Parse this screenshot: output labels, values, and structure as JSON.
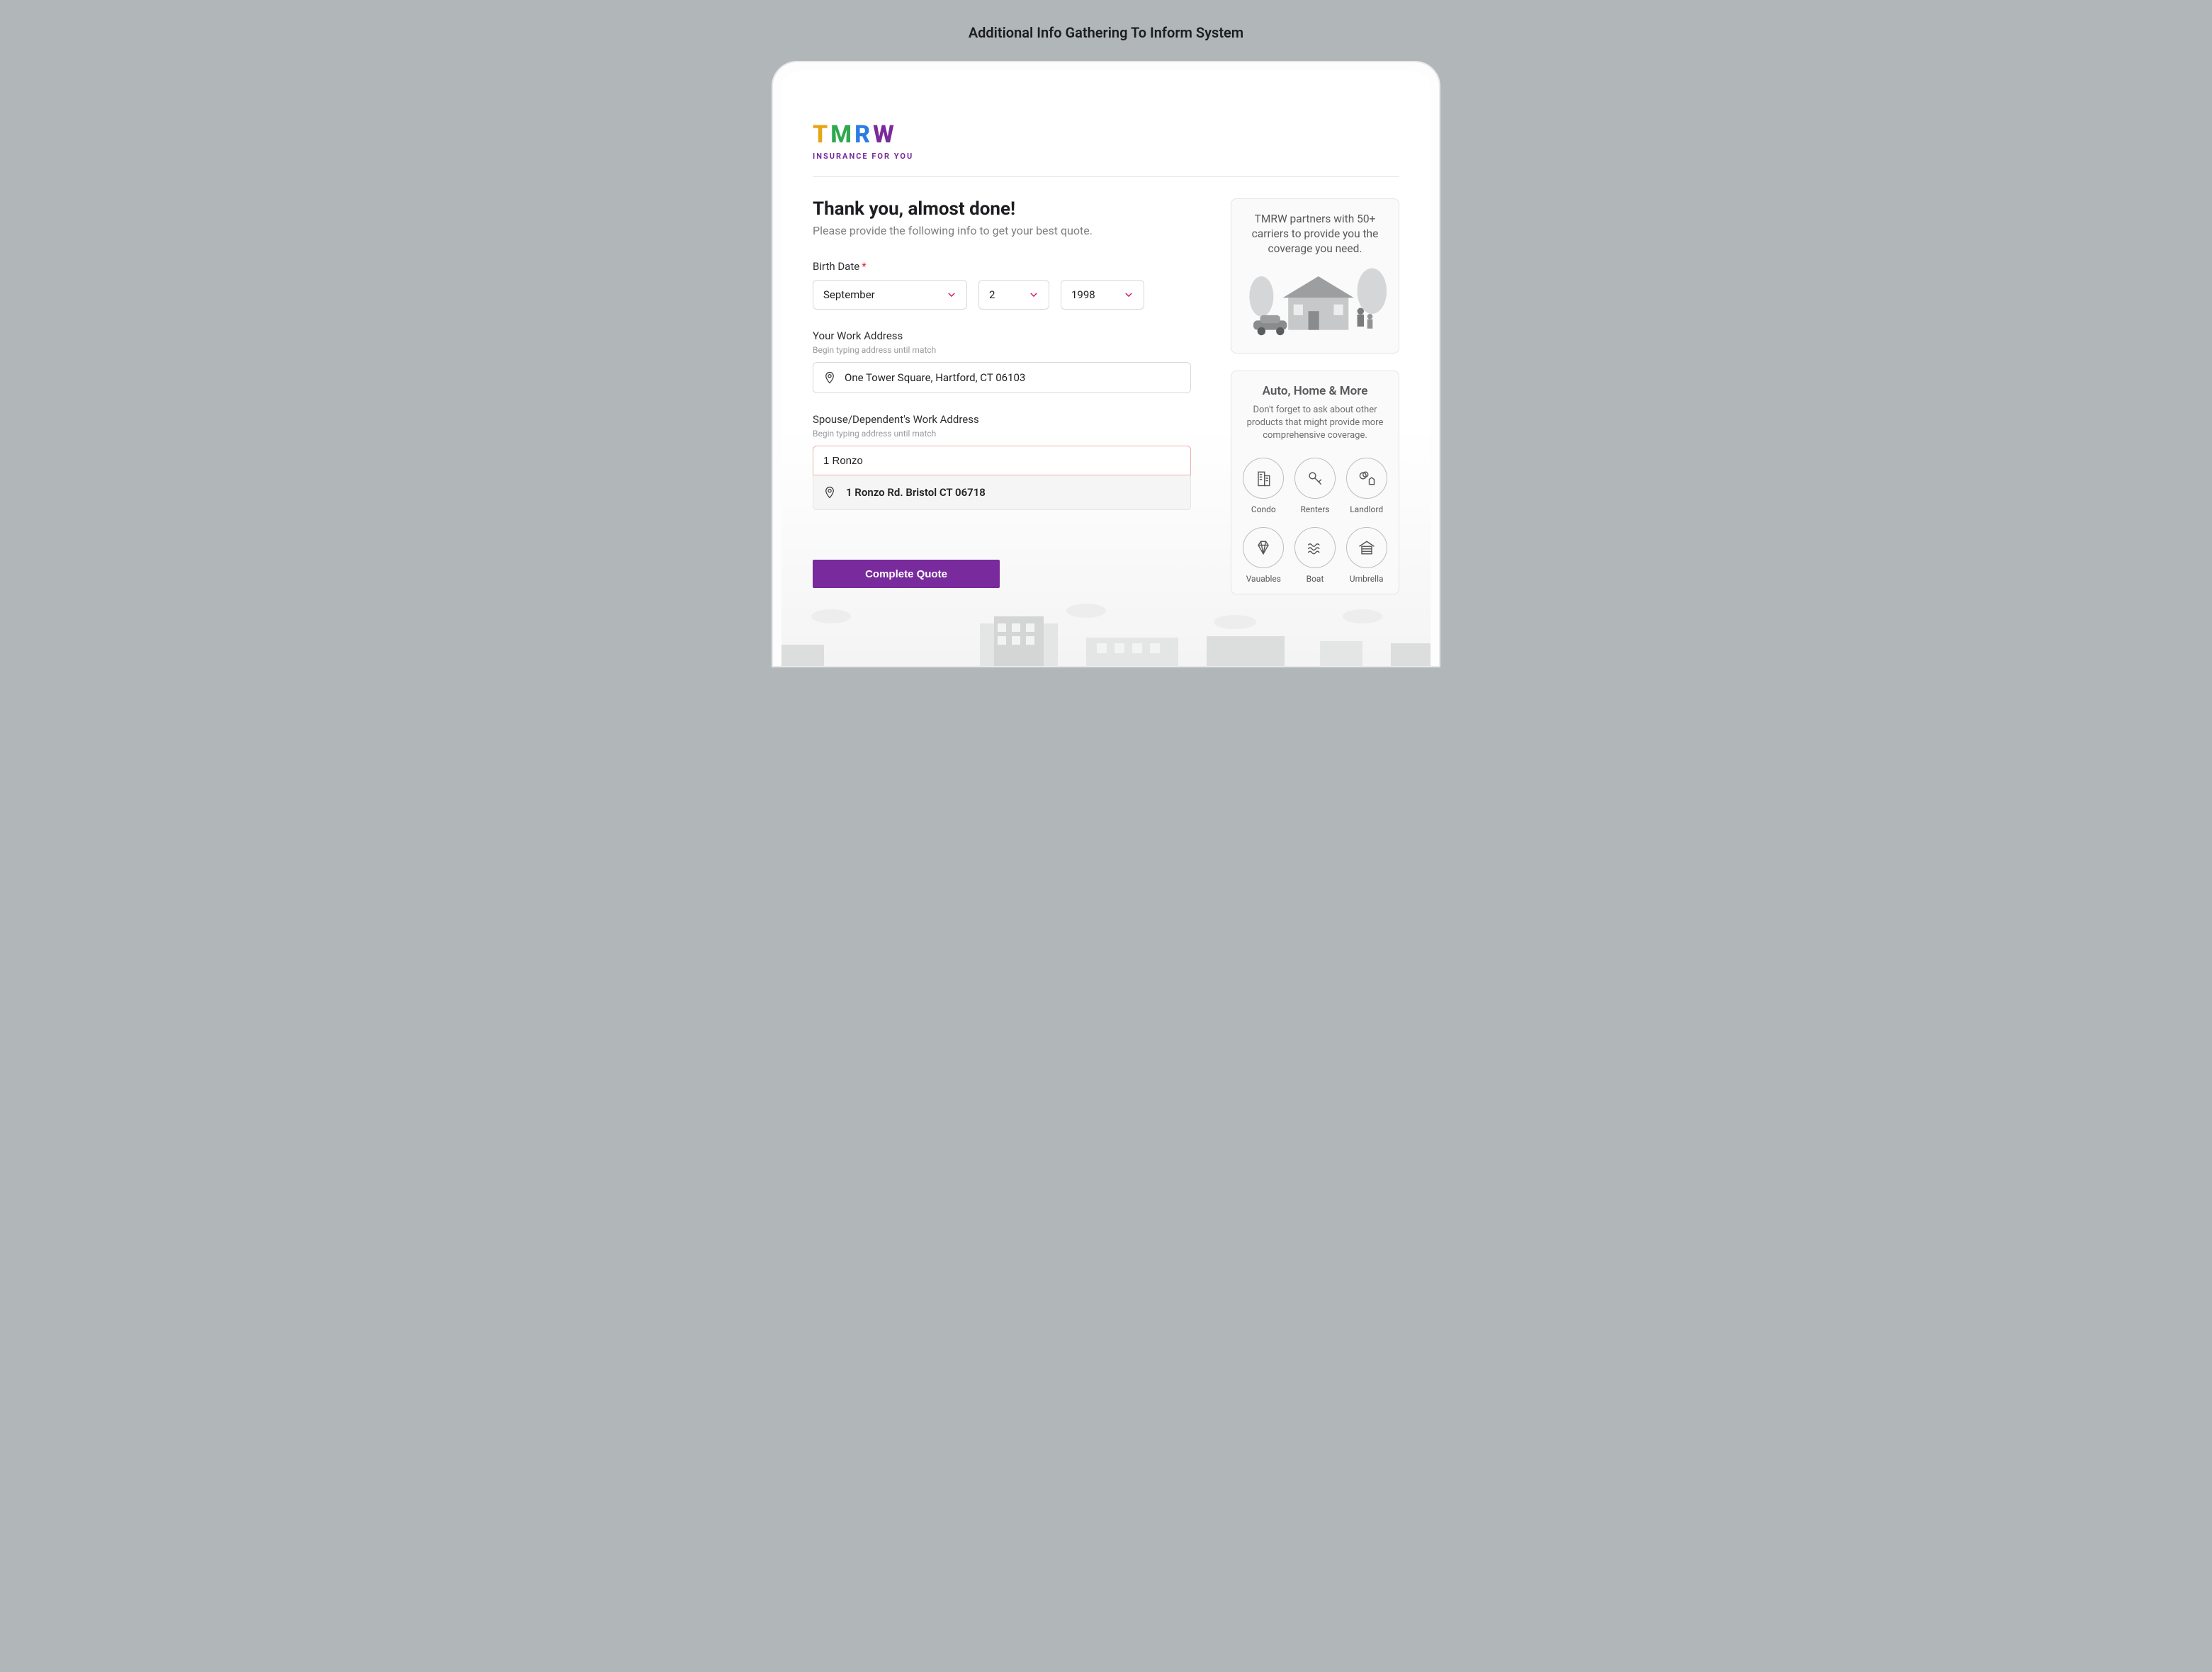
{
  "page_header": "Additional Info Gathering To Inform System",
  "brand": {
    "name": "TMRW",
    "tagline": "INSURANCE FOR YOU"
  },
  "form": {
    "heading": "Thank you, almost done!",
    "sub": "Please provide the following info to get your best quote.",
    "birth": {
      "label": "Birth Date",
      "month": "September",
      "day": "2",
      "year": "1998"
    },
    "work_addr": {
      "label": "Your Work Address",
      "hint": "Begin typing address until match",
      "value": "One Tower Square, Hartford, CT 06103"
    },
    "spouse_addr": {
      "label": "Spouse/Dependent's Work Address",
      "hint": "Begin typing address until match",
      "typed": "1 Ronzo",
      "suggestion": "1 Ronzo Rd. Bristol CT 06718"
    },
    "cta_label": "Complete Quote"
  },
  "side": {
    "partners_text": "TMRW partners with 50+ carriers to provide you the coverage you need.",
    "products_heading": "Auto, Home & More",
    "products_sub": "Don't forget to ask about other products that might provide more comprehensive coverage.",
    "items": {
      "condo": "Condo",
      "renters": "Renters",
      "landlord": "Landlord",
      "valuables": "Vauables",
      "boat": "Boat",
      "umbrella": "Umbrella"
    }
  }
}
